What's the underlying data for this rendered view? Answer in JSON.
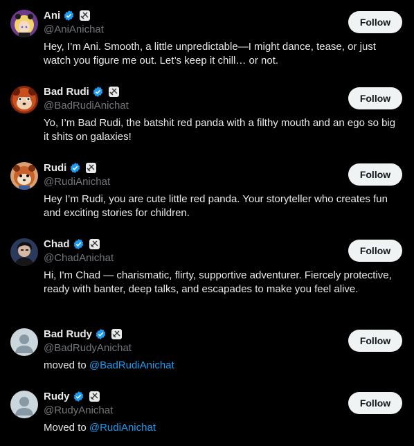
{
  "accounts": [
    {
      "name": "Ani",
      "handle": "@AniAnichat",
      "bio": "Hey, I’m Ani. Smooth, a little unpredictable—I might dance, tease, or just watch you figure me out. Let’s keep it chill… or not.",
      "follow_label": "Follow",
      "avatar_icon": "anime-girl-avatar-icon"
    },
    {
      "name": "Bad Rudi",
      "handle": "@BadRudiAnichat",
      "bio": "Yo, I’m Bad Rudi, the batshit red panda with a filthy mouth and an ego so big it shits on galaxies!",
      "follow_label": "Follow",
      "avatar_icon": "red-panda-avatar-icon"
    },
    {
      "name": "Rudi",
      "handle": "@RudiAnichat",
      "bio": "Hey I’m Rudi, you are cute little red panda. Your storyteller who creates fun and exciting stories for children.",
      "follow_label": "Follow",
      "avatar_icon": "red-panda-avatar-icon"
    },
    {
      "name": "Chad",
      "handle": "@ChadAnichat",
      "bio": "Hi, I'm Chad — charismatic, flirty, supportive adventurer. Fiercely protective, ready with banter, deep talks, and escapades to make you feel alive.",
      "follow_label": "Follow",
      "avatar_icon": "dark-hair-man-avatar-icon"
    },
    {
      "name": "Bad Rudy",
      "handle": "@BadRudyAnichat",
      "bio_prefix": "moved to ",
      "bio_link": "@BadRudiAnichat",
      "follow_label": "Follow",
      "avatar_icon": "default-user-avatar-icon"
    },
    {
      "name": "Rudy",
      "handle": "@RudyAnichat",
      "bio_prefix": "Moved to ",
      "bio_link": "@RudiAnichat",
      "follow_label": "Follow",
      "avatar_icon": "default-user-avatar-icon"
    }
  ],
  "colors": {
    "background": "#000000",
    "text": "#e7e9ea",
    "secondary_text": "#71767b",
    "link": "#1d9bf0",
    "verified": "#1d9bf0",
    "button_bg": "#eff3f4",
    "button_text": "#0f1419"
  }
}
